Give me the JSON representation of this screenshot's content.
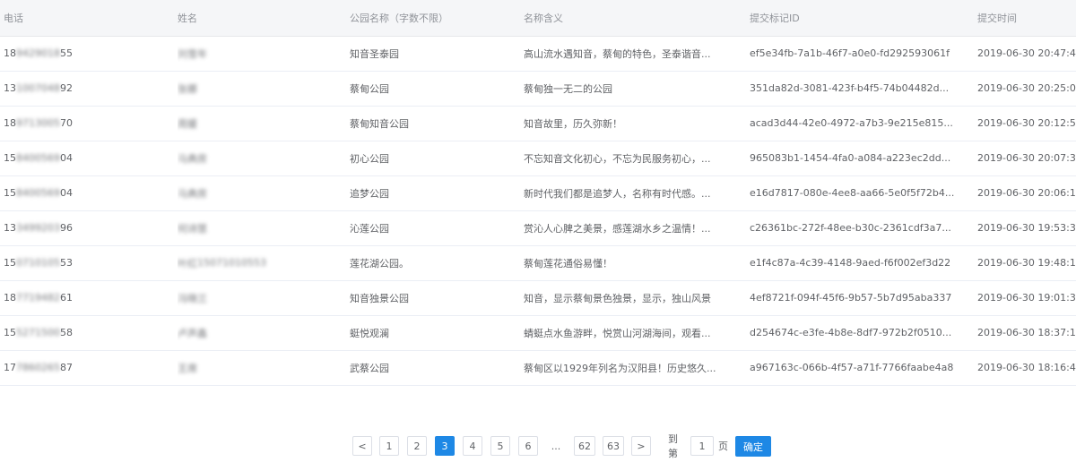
{
  "table": {
    "headers": [
      "电话",
      "姓名",
      "公园名称（字数不限）",
      "名称含义",
      "提交标记ID",
      "提交时间"
    ],
    "rows": [
      {
        "phone_a": "18",
        "phone_blur": "9429018",
        "phone_b": "55",
        "name": "刘雪年",
        "name_extra": "",
        "park": "知音圣泰园",
        "meaning": "高山流水遇知音，蔡甸的特色，圣泰谐音...",
        "id": "ef5e34fb-7a1b-46f7-a0e0-fd292593061f",
        "time": "2019-06-30 20:47:43"
      },
      {
        "phone_a": "13",
        "phone_blur": "1007048",
        "phone_b": "92",
        "name": "张娜",
        "name_extra": "",
        "park": "蔡甸公园",
        "meaning": "蔡甸独一无二的公园",
        "id": "351da82d-3081-423f-b4f5-74b04482d...",
        "time": "2019-06-30 20:25:09"
      },
      {
        "phone_a": "18",
        "phone_blur": "9713005",
        "phone_b": "70",
        "name": "周媛",
        "name_extra": "",
        "park": "蔡甸知音公园",
        "meaning": "知音故里，历久弥新！",
        "id": "acad3d44-42e0-4972-a7b3-9e215e815...",
        "time": "2019-06-30 20:12:52"
      },
      {
        "phone_a": "15",
        "phone_blur": "8400569",
        "phone_b": "04",
        "name": "马典房",
        "name_extra": "",
        "park": "初心公园",
        "meaning": "不忘知音文化初心，不忘为民服务初心，...",
        "id": "965083b1-1454-4fa0-a084-a223ec2dd...",
        "time": "2019-06-30 20:07:30"
      },
      {
        "phone_a": "15",
        "phone_blur": "8400569",
        "phone_b": "04",
        "name": "马典房",
        "name_extra": "",
        "park": "追梦公园",
        "meaning": "新时代我们都是追梦人，名称有时代感。...",
        "id": "e16d7817-080e-4ee8-aa66-5e0f5f72b4...",
        "time": "2019-06-30 20:06:10"
      },
      {
        "phone_a": "13",
        "phone_blur": "3499203",
        "phone_b": "96",
        "name": "何诗慧",
        "name_extra": "",
        "park": "沁莲公园",
        "meaning": "赏沁人心脾之美景，感莲湖水乡之温情！...",
        "id": "c26361bc-272f-48ee-b30c-2361cdf3a7...",
        "time": "2019-06-30 19:53:30"
      },
      {
        "phone_a": "15",
        "phone_blur": "0710105",
        "phone_b": "53",
        "name": "叶红",
        "name_extra": "15071010553",
        "park": "莲花湖公园。",
        "meaning": "蔡甸莲花通俗易懂！",
        "id": "e1f4c87a-4c39-4148-9aed-f6f002ef3d22",
        "time": "2019-06-30 19:48:14"
      },
      {
        "phone_a": "18",
        "phone_blur": "7719482",
        "phone_b": "61",
        "name": "冯晓兰",
        "name_extra": "",
        "park": "知音独景公园",
        "meaning": "知音，显示蔡甸景色独景，显示，独山风景",
        "id": "4ef8721f-094f-45f6-9b57-5b7d95aba337",
        "time": "2019-06-30 19:01:36"
      },
      {
        "phone_a": "15",
        "phone_blur": "5271500",
        "phone_b": "58",
        "name": "卢声鑫",
        "name_extra": "",
        "park": "蜓悦观澜",
        "meaning": "蜻蜓点水鱼游畔，悦赏山河湖海间，观看...",
        "id": "d254674c-e3fe-4b8e-8df7-972b2f0510...",
        "time": "2019-06-30 18:37:18"
      },
      {
        "phone_a": "17",
        "phone_blur": "7860265",
        "phone_b": "87",
        "name": "王席",
        "name_extra": "",
        "park": "武蔡公园",
        "meaning": "蔡甸区以1929年列名为汉阳县！历史悠久...",
        "id": "a967163c-066b-4f57-a71f-7766faabe4a8",
        "time": "2019-06-30 18:16:44"
      }
    ]
  },
  "pagination": {
    "prev": "<",
    "next": ">",
    "pages": [
      "1",
      "2",
      "3",
      "4",
      "5",
      "6"
    ],
    "current": "3",
    "ellipsis": "...",
    "last_pages": [
      "62",
      "63"
    ],
    "goto_label": "到第",
    "goto_value": "1",
    "page_suffix": "页",
    "confirm": "确定"
  }
}
